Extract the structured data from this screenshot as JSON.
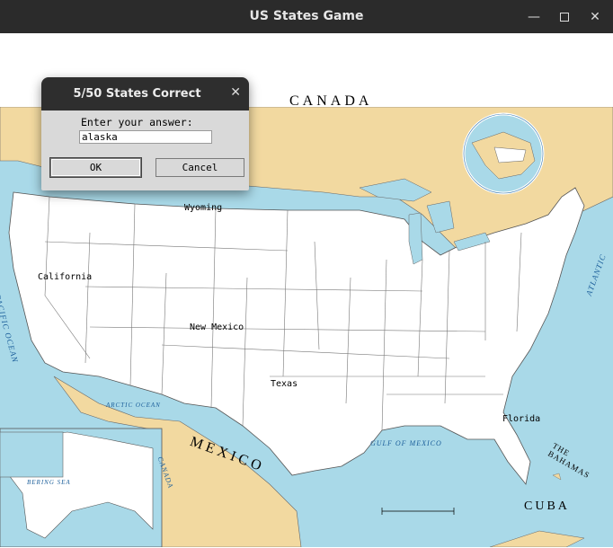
{
  "window": {
    "title": "US States Game"
  },
  "dialog": {
    "title": "5/50 States Correct",
    "prompt": "Enter your answer:",
    "answer_value": "alaska",
    "ok_label": "OK",
    "cancel_label": "Cancel"
  },
  "map": {
    "country_labels": {
      "canada": "CANADA",
      "mexico": "MEXICO",
      "cuba": "CUBA",
      "bahamas": "THE BAHAMAS"
    },
    "guessed_states": [
      "Wyoming",
      "California",
      "New Mexico",
      "Texas",
      "Florida"
    ],
    "water_labels": {
      "gulf": "GULF OF MEXICO",
      "atlantic": "ATLANTIC",
      "pacific": "PACIFIC OCEAN",
      "arctic": "ARCTIC OCEAN",
      "bering": "BERING SEA",
      "inset_canada": "CANADA"
    },
    "colors": {
      "water": "#a9d9e8",
      "land_other": "#f2d9a0",
      "us_land": "#ffffff",
      "border": "#6e6e6e"
    }
  }
}
